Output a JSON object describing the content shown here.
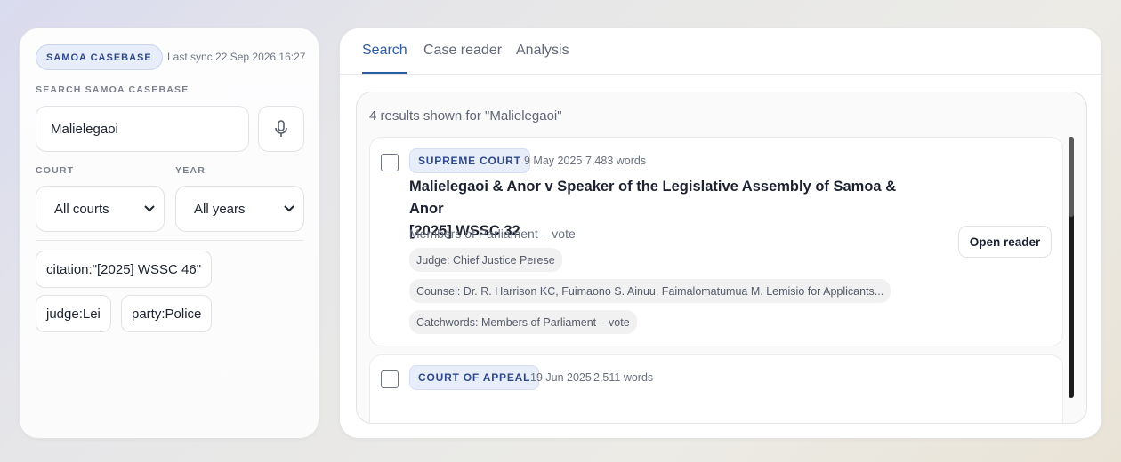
{
  "sidebar": {
    "brand": "SAMOA CASEBASE",
    "last_sync": "Last sync 22 Sep 2026 16:27",
    "search_label": "SEARCH SAMOA CASEBASE",
    "search_value": "Malielegaoi",
    "mic_icon": "microphone-icon",
    "court_label": "COURT",
    "court_value": "All courts",
    "year_label": "YEAR",
    "year_value": "All years",
    "chips": [
      "citation:\"[2025] WSSC 46\"",
      "judge:Lei",
      "party:Police"
    ]
  },
  "tabs": [
    "Search",
    "Case reader",
    "Analysis"
  ],
  "active_tab": "Search",
  "results": {
    "count_text": "4 results shown for \"Malielegaoi\"",
    "items": [
      {
        "court": "SUPREME COURT",
        "date": "9 May 2025",
        "words": "7,483 words",
        "title_line1": "Malielegaoi & Anor v Speaker of the Legislative Assembly of Samoa & Anor",
        "title_line2": "[2025] WSSC 32",
        "subject": "Members of Parliament – vote",
        "judge": "Judge: Chief Justice Perese",
        "counsel": "Counsel: Dr. R. Harrison KC, Fuimaono S. Ainuu, Faimalomatumua M. Lemisio for Applicants...",
        "catchwords": "Catchwords: Members of Parliament – vote",
        "open_label": "Open reader"
      },
      {
        "court": "COURT OF APPEAL",
        "date": "19 Jun 2025",
        "words": "2,511 words"
      }
    ]
  },
  "colors": {
    "accent": "#2c5aa5",
    "badge_bg": "#e8edfa",
    "badge_text": "#2e4a8c"
  }
}
